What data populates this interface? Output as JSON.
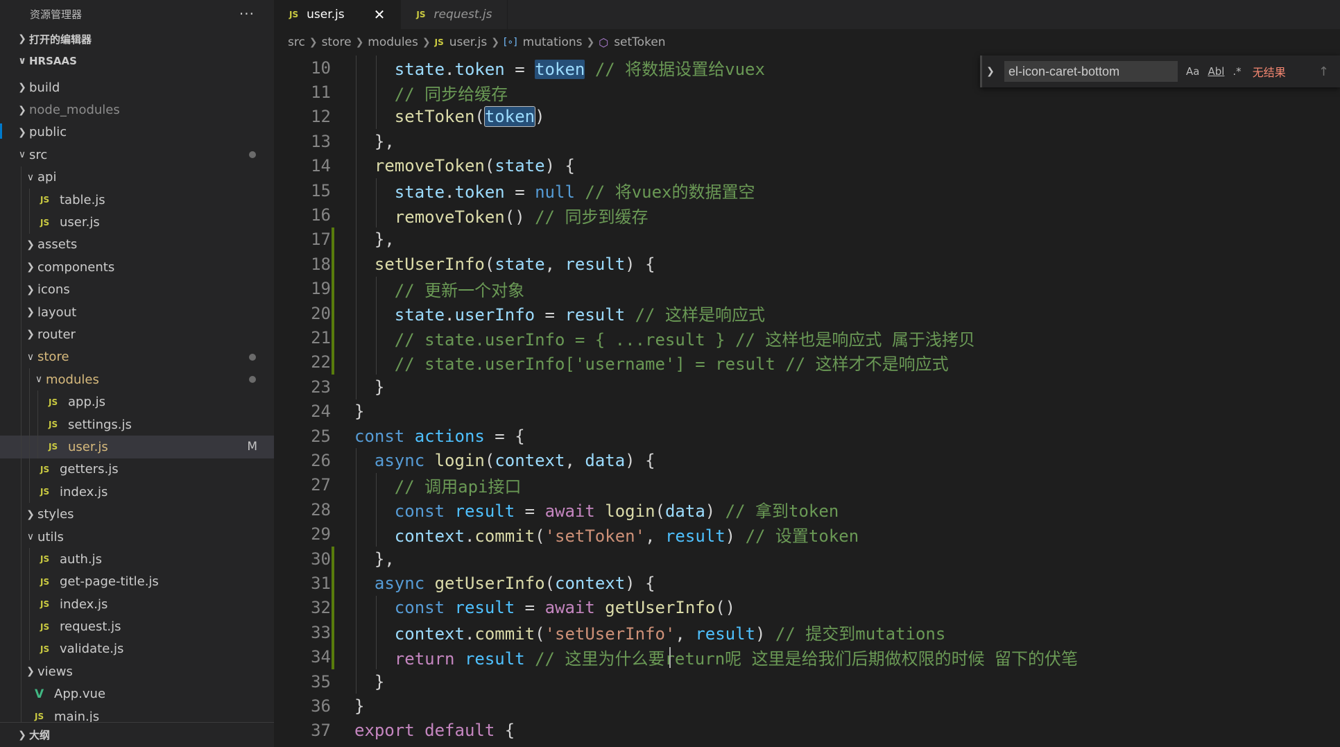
{
  "sidebar": {
    "title": "资源管理器",
    "more_label": "···",
    "open_editors_label": "打开的编辑器",
    "project_label": "HRSAAS",
    "outline_label": "大纲",
    "tree": [
      {
        "label": "build",
        "type": "folder",
        "depth": 1,
        "expanded": false
      },
      {
        "label": "node_modules",
        "type": "folder",
        "depth": 1,
        "expanded": false,
        "dim": true
      },
      {
        "label": "public",
        "type": "folder",
        "depth": 1,
        "expanded": false
      },
      {
        "label": "src",
        "type": "folder",
        "depth": 1,
        "expanded": true,
        "dot": true
      },
      {
        "label": "api",
        "type": "folder",
        "depth": 2,
        "expanded": true
      },
      {
        "label": "table.js",
        "type": "js",
        "depth": 3
      },
      {
        "label": "user.js",
        "type": "js",
        "depth": 3
      },
      {
        "label": "assets",
        "type": "folder",
        "depth": 2,
        "expanded": false
      },
      {
        "label": "components",
        "type": "folder",
        "depth": 2,
        "expanded": false
      },
      {
        "label": "icons",
        "type": "folder",
        "depth": 2,
        "expanded": false
      },
      {
        "label": "layout",
        "type": "folder",
        "depth": 2,
        "expanded": false
      },
      {
        "label": "router",
        "type": "folder",
        "depth": 2,
        "expanded": false
      },
      {
        "label": "store",
        "type": "folder",
        "depth": 2,
        "expanded": true,
        "dot": true,
        "modified": true
      },
      {
        "label": "modules",
        "type": "folder",
        "depth": 3,
        "expanded": true,
        "dot": true,
        "modified": true
      },
      {
        "label": "app.js",
        "type": "js",
        "depth": 4
      },
      {
        "label": "settings.js",
        "type": "js",
        "depth": 4
      },
      {
        "label": "user.js",
        "type": "js",
        "depth": 4,
        "selected": true,
        "badge": "M",
        "modified": true
      },
      {
        "label": "getters.js",
        "type": "js",
        "depth": 3
      },
      {
        "label": "index.js",
        "type": "js",
        "depth": 3
      },
      {
        "label": "styles",
        "type": "folder",
        "depth": 2,
        "expanded": false
      },
      {
        "label": "utils",
        "type": "folder",
        "depth": 2,
        "expanded": true
      },
      {
        "label": "auth.js",
        "type": "js",
        "depth": 3
      },
      {
        "label": "get-page-title.js",
        "type": "js",
        "depth": 3
      },
      {
        "label": "index.js",
        "type": "js",
        "depth": 3
      },
      {
        "label": "request.js",
        "type": "js",
        "depth": 3
      },
      {
        "label": "validate.js",
        "type": "js",
        "depth": 3
      },
      {
        "label": "views",
        "type": "folder",
        "depth": 2,
        "expanded": false
      },
      {
        "label": "App.vue",
        "type": "vue",
        "depth": 2
      },
      {
        "label": "main.js",
        "type": "js",
        "depth": 2
      }
    ]
  },
  "tabs": [
    {
      "label": "user.js",
      "active": true,
      "icon": "js-file-icon",
      "js_tag": "JS",
      "close": "✕"
    },
    {
      "label": "request.js",
      "active": false,
      "italic": true,
      "icon": "js-file-icon",
      "js_tag": "JS"
    }
  ],
  "breadcrumb": [
    "src",
    "store",
    "modules",
    "user.js",
    "mutations",
    "setToken"
  ],
  "breadcrumb_js_tag": "JS",
  "find": {
    "value": "el-icon-caret-bottom",
    "match_case_label": "Aa",
    "whole_word_label": "Abl",
    "regex_label": ".*",
    "result": "无结果"
  },
  "code": [
    {
      "n": "10",
      "tokens": [
        [
          "    ",
          ""
        ],
        [
          "state",
          "var"
        ],
        [
          ".",
          "pun"
        ],
        [
          "token",
          "var"
        ],
        [
          " = ",
          "pun"
        ],
        [
          "token",
          "var hl"
        ],
        [
          " ",
          "pun"
        ],
        [
          "// 将数据设置给vuex",
          "cmt"
        ]
      ]
    },
    {
      "n": "11",
      "tokens": [
        [
          "    ",
          ""
        ],
        [
          "// 同步给缓存",
          "cmt"
        ]
      ]
    },
    {
      "n": "12",
      "tokens": [
        [
          "    ",
          ""
        ],
        [
          "setToken",
          "fn"
        ],
        [
          "(",
          "pun"
        ],
        [
          "token",
          "var hl hlbox"
        ],
        [
          ")",
          "pun"
        ]
      ]
    },
    {
      "n": "13",
      "tokens": [
        [
          "  ",
          ""
        ],
        [
          "},",
          "pun"
        ]
      ]
    },
    {
      "n": "14",
      "tokens": [
        [
          "  ",
          ""
        ],
        [
          "removeToken",
          "fn"
        ],
        [
          "(",
          "pun"
        ],
        [
          "state",
          "var"
        ],
        [
          ") {",
          "pun"
        ]
      ]
    },
    {
      "n": "15",
      "tokens": [
        [
          "    ",
          ""
        ],
        [
          "state",
          "var"
        ],
        [
          ".",
          "pun"
        ],
        [
          "token",
          "var"
        ],
        [
          " = ",
          "pun"
        ],
        [
          "null",
          "kw"
        ],
        [
          " ",
          "pun"
        ],
        [
          "// 将vuex的数据置空",
          "cmt"
        ]
      ]
    },
    {
      "n": "16",
      "tokens": [
        [
          "    ",
          ""
        ],
        [
          "removeToken",
          "fn"
        ],
        [
          "() ",
          "pun"
        ],
        [
          "// 同步到缓存",
          "cmt"
        ]
      ]
    },
    {
      "n": "17",
      "tokens": [
        [
          "  ",
          ""
        ],
        [
          "},",
          "pun"
        ]
      ]
    },
    {
      "n": "18",
      "tokens": [
        [
          "  ",
          ""
        ],
        [
          "setUserInfo",
          "fn"
        ],
        [
          "(",
          "pun"
        ],
        [
          "state",
          "var"
        ],
        [
          ", ",
          "pun"
        ],
        [
          "result",
          "var"
        ],
        [
          ") {",
          "pun"
        ]
      ]
    },
    {
      "n": "19",
      "tokens": [
        [
          "    ",
          ""
        ],
        [
          "// 更新一个对象",
          "cmt"
        ]
      ]
    },
    {
      "n": "20",
      "tokens": [
        [
          "    ",
          ""
        ],
        [
          "state",
          "var"
        ],
        [
          ".",
          "pun"
        ],
        [
          "userInfo",
          "var"
        ],
        [
          " = ",
          "pun"
        ],
        [
          "result",
          "var"
        ],
        [
          " ",
          "pun"
        ],
        [
          "// 这样是响应式",
          "cmt"
        ]
      ]
    },
    {
      "n": "21",
      "tokens": [
        [
          "    ",
          ""
        ],
        [
          "// state.userInfo = { ...result } // 这样也是响应式 属于浅拷贝",
          "cmt"
        ]
      ]
    },
    {
      "n": "22",
      "tokens": [
        [
          "    ",
          ""
        ],
        [
          "// state.userInfo['username'] = result // 这样才不是响应式",
          "cmt"
        ]
      ]
    },
    {
      "n": "23",
      "tokens": [
        [
          "  ",
          ""
        ],
        [
          "}",
          "pun"
        ]
      ]
    },
    {
      "n": "24",
      "tokens": [
        [
          "}",
          "pun"
        ]
      ]
    },
    {
      "n": "25",
      "tokens": [
        [
          "const",
          "kw"
        ],
        [
          " ",
          "pun"
        ],
        [
          "actions",
          "cst"
        ],
        [
          " = {",
          "pun"
        ]
      ]
    },
    {
      "n": "26",
      "tokens": [
        [
          "  ",
          ""
        ],
        [
          "async",
          "kw"
        ],
        [
          " ",
          "pun"
        ],
        [
          "login",
          "fn"
        ],
        [
          "(",
          "pun"
        ],
        [
          "context",
          "var"
        ],
        [
          ", ",
          "pun"
        ],
        [
          "data",
          "var"
        ],
        [
          ") {",
          "pun"
        ]
      ]
    },
    {
      "n": "27",
      "tokens": [
        [
          "    ",
          ""
        ],
        [
          "// 调用api接口",
          "cmt"
        ]
      ]
    },
    {
      "n": "28",
      "tokens": [
        [
          "    ",
          ""
        ],
        [
          "const",
          "kw"
        ],
        [
          " ",
          "pun"
        ],
        [
          "result",
          "cst"
        ],
        [
          " = ",
          "pun"
        ],
        [
          "await",
          "ctl"
        ],
        [
          " ",
          "pun"
        ],
        [
          "login",
          "fn"
        ],
        [
          "(",
          "pun"
        ],
        [
          "data",
          "var"
        ],
        [
          ") ",
          "pun"
        ],
        [
          "// 拿到token",
          "cmt"
        ]
      ]
    },
    {
      "n": "29",
      "tokens": [
        [
          "    ",
          ""
        ],
        [
          "context",
          "var"
        ],
        [
          ".",
          "pun"
        ],
        [
          "commit",
          "fn"
        ],
        [
          "(",
          "pun"
        ],
        [
          "'setToken'",
          "str"
        ],
        [
          ", ",
          "pun"
        ],
        [
          "result",
          "cst"
        ],
        [
          ") ",
          "pun"
        ],
        [
          "// 设置token",
          "cmt"
        ]
      ]
    },
    {
      "n": "30",
      "tokens": [
        [
          "  ",
          ""
        ],
        [
          "},",
          "pun"
        ]
      ]
    },
    {
      "n": "31",
      "tokens": [
        [
          "  ",
          ""
        ],
        [
          "async",
          "kw"
        ],
        [
          " ",
          "pun"
        ],
        [
          "getUserInfo",
          "fn"
        ],
        [
          "(",
          "pun"
        ],
        [
          "context",
          "var"
        ],
        [
          ") {",
          "pun"
        ]
      ]
    },
    {
      "n": "32",
      "tokens": [
        [
          "    ",
          ""
        ],
        [
          "const",
          "kw"
        ],
        [
          " ",
          "pun"
        ],
        [
          "result",
          "cst"
        ],
        [
          " = ",
          "pun"
        ],
        [
          "await",
          "ctl"
        ],
        [
          " ",
          "pun"
        ],
        [
          "getUserInfo",
          "fn"
        ],
        [
          "()",
          "pun"
        ]
      ]
    },
    {
      "n": "33",
      "tokens": [
        [
          "    ",
          ""
        ],
        [
          "context",
          "var"
        ],
        [
          ".",
          "pun"
        ],
        [
          "commit",
          "fn"
        ],
        [
          "(",
          "pun"
        ],
        [
          "'setUserInfo'",
          "str"
        ],
        [
          ", ",
          "pun"
        ],
        [
          "result",
          "cst"
        ],
        [
          ") ",
          "pun"
        ],
        [
          "// 提交到mutations",
          "cmt"
        ]
      ]
    },
    {
      "n": "34",
      "tokens": [
        [
          "    ",
          ""
        ],
        [
          "return",
          "ctl"
        ],
        [
          " ",
          "pun"
        ],
        [
          "result",
          "cst"
        ],
        [
          " ",
          "pun"
        ],
        [
          "// 这里为什么要return呢 这里是给我们后期做权限的时候 留下的伏笔",
          "cmt"
        ]
      ]
    },
    {
      "n": "35",
      "tokens": [
        [
          "  ",
          ""
        ],
        [
          "}",
          "pun"
        ]
      ]
    },
    {
      "n": "36",
      "tokens": [
        [
          "}",
          "pun"
        ]
      ]
    },
    {
      "n": "37",
      "tokens": [
        [
          "export",
          "ctl"
        ],
        [
          " ",
          "pun"
        ],
        [
          "default",
          "ctl"
        ],
        [
          " {",
          "pun"
        ]
      ]
    }
  ],
  "colors": {
    "accent": "#007acc",
    "modified": "#d7ba7d",
    "gutter_modified": "#587c0c"
  }
}
